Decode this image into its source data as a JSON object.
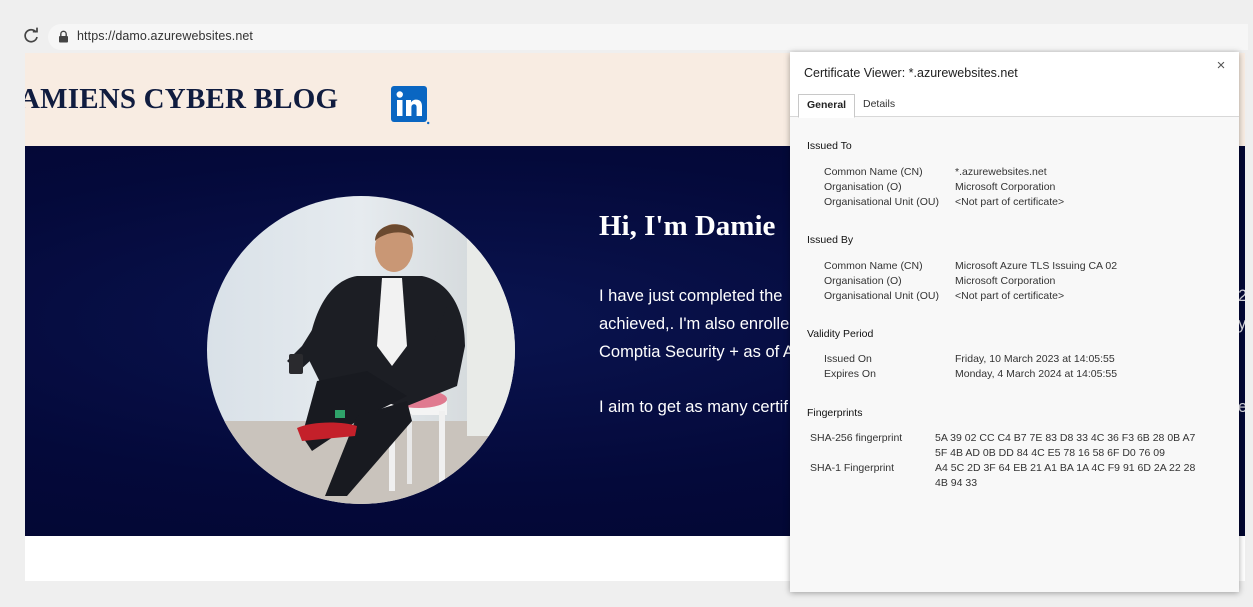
{
  "browser": {
    "url": "https://damo.azurewebsites.net",
    "icons": {
      "reload": "reload-icon",
      "lock": "lock-icon"
    }
  },
  "site": {
    "title": "AMIENS CYBER BLOG",
    "social_icon": "linkedin-icon",
    "hero": {
      "heading": "Hi, I'm Damie",
      "lines": [
        "I have just completed the",
        "achieved,. I'm also enrolle",
        "Comptia Security + as of A",
        "I aim to get as many certif"
      ],
      "edge_chars": [
        "2",
        "y",
        "e"
      ]
    }
  },
  "cert_viewer": {
    "title": "Certificate Viewer: *.azurewebsites.net",
    "close_label": "×",
    "tabs": [
      "General",
      "Details"
    ],
    "issued_to": {
      "heading": "Issued To",
      "rows": [
        {
          "label": "Common Name (CN)",
          "value": "*.azurewebsites.net"
        },
        {
          "label": "Organisation (O)",
          "value": "Microsoft Corporation"
        },
        {
          "label": "Organisational Unit (OU)",
          "value": "<Not part of certificate>"
        }
      ]
    },
    "issued_by": {
      "heading": "Issued By",
      "rows": [
        {
          "label": "Common Name (CN)",
          "value": "Microsoft Azure TLS Issuing CA 02"
        },
        {
          "label": "Organisation (O)",
          "value": "Microsoft Corporation"
        },
        {
          "label": "Organisational Unit (OU)",
          "value": "<Not part of certificate>"
        }
      ]
    },
    "validity": {
      "heading": "Validity Period",
      "rows": [
        {
          "label": "Issued On",
          "value": "Friday, 10 March 2023 at 14:05:55"
        },
        {
          "label": "Expires On",
          "value": "Monday, 4 March 2024 at 14:05:55"
        }
      ]
    },
    "fingerprints": {
      "heading": "Fingerprints",
      "rows": [
        {
          "label": "SHA-256 fingerprint",
          "value": "5A 39 02 CC C4 B7 7E 83 D8 33 4C 36 F3 6B 28 0B A7 5F 4B AD 0B DD 84 4C E5 78 16 58 6F D0 76 09"
        },
        {
          "label": "SHA-1 Fingerprint",
          "value": "A4 5C 2D 3F 64 EB 21 A1 BA 1A 4C F9 91 6D 2A 22 28 4B 94 33"
        }
      ]
    }
  },
  "colors": {
    "header_bg": "#f8ece2",
    "hero_bg": "#04093a",
    "title_color": "#101c3f",
    "linkedin_blue": "#0a66c2"
  }
}
